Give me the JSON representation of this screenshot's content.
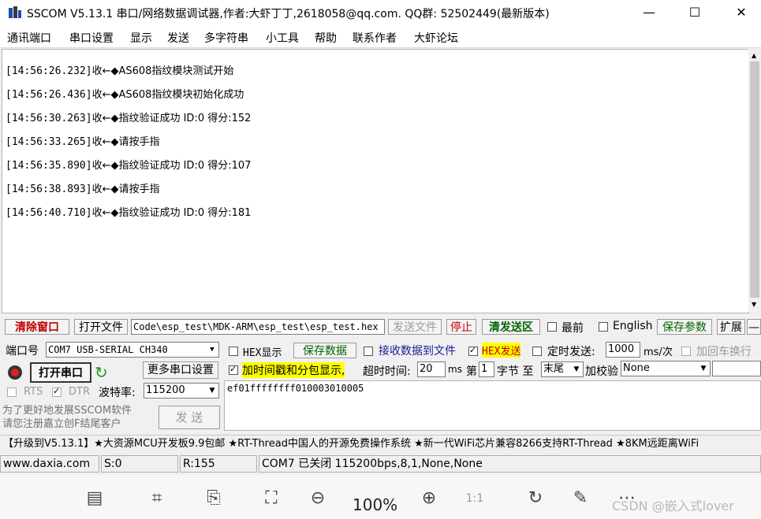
{
  "window": {
    "title": "SSCOM V5.13.1 串口/网络数据调试器,作者:大虾丁丁,2618058@qq.com. QQ群:  52502449(最新版本)",
    "minimize": "—",
    "maximize": "☐",
    "close": "✕"
  },
  "menu": [
    "通讯端口",
    "串口设置",
    "显示",
    "发送",
    "多字符串",
    "小工具",
    "帮助",
    "联系作者",
    "大虾论坛"
  ],
  "log": [
    {
      "time": "[14:56:26.232]",
      "dir": "收←◆",
      "msg": "AS608指纹模块测试开始"
    },
    {
      "time": "[14:56:26.436]",
      "dir": "收←◆",
      "msg": "AS608指纹模块初始化成功"
    },
    {
      "time": "[14:56:30.263]",
      "dir": "收←◆",
      "msg": "指纹验证成功 ID:0 得分:152"
    },
    {
      "time": "[14:56:33.265]",
      "dir": "收←◆",
      "msg": "请按手指"
    },
    {
      "time": "[14:56:35.890]",
      "dir": "收←◆",
      "msg": "指纹验证成功 ID:0 得分:107"
    },
    {
      "time": "[14:56:38.893]",
      "dir": "收←◆",
      "msg": "请按手指"
    },
    {
      "time": "[14:56:40.710]",
      "dir": "收←◆",
      "msg": "指纹验证成功 ID:0 得分:181"
    }
  ],
  "toolbar1": {
    "clear": "清除窗口",
    "open_file": "打开文件",
    "file_path": "Code\\esp_test\\MDK-ARM\\esp_test\\esp_test.hex",
    "send_file": "发送文件",
    "stop": "停止",
    "clear_send": "清发送区",
    "topmost": "最前",
    "english": "English",
    "save_params": "保存参数",
    "expand": "扩展",
    "collapse": "—"
  },
  "port": {
    "label": "端口号",
    "value": "COM7 USB-SERIAL CH340",
    "open_btn": "打开串口",
    "more_settings": "更多串口设置",
    "rts": "RTS",
    "dtr": "DTR",
    "baud_label": "波特率:",
    "baud_value": "115200"
  },
  "options": {
    "hex_display": "HEX显示",
    "save_data": "保存数据",
    "recv_to_file": "接收数据到文件",
    "hex_send": "HEX发送",
    "timed_send": "定时发送:",
    "interval": "1000",
    "interval_unit": "ms/次",
    "add_crlf": "加回车换行",
    "timestamp": "加时间戳和分包显示,",
    "timeout_label": "超时时间:",
    "timeout_value": "20",
    "timeout_unit": "ms",
    "nth": "第",
    "byte_index": "1",
    "byte_unit": "字节 至",
    "end_value": "末尾",
    "checksum_label": "加校验",
    "checksum_value": "None"
  },
  "send": {
    "text": "ef01ffffffff010003010005",
    "button": "发  送",
    "promo": "为了更好地发展SSCOM软件\n请您注册嘉立创F结尾客户"
  },
  "ticker": "【升级到V5.13.1】★大资源MCU开发板9.9包邮 ★RT-Thread中国人的开源免费操作系统 ★新一代WiFi芯片兼容8266支持RT-Thread ★8KM远距离WiFi",
  "status": {
    "site": "www.daxia.com",
    "sent": "S:0",
    "recv": "R:155",
    "port_state": "COM7 已关闭  115200bps,8,1,None,None"
  },
  "viewer": {
    "zoom": "100%",
    "watermark": "CSDN @嵌入式lover"
  }
}
